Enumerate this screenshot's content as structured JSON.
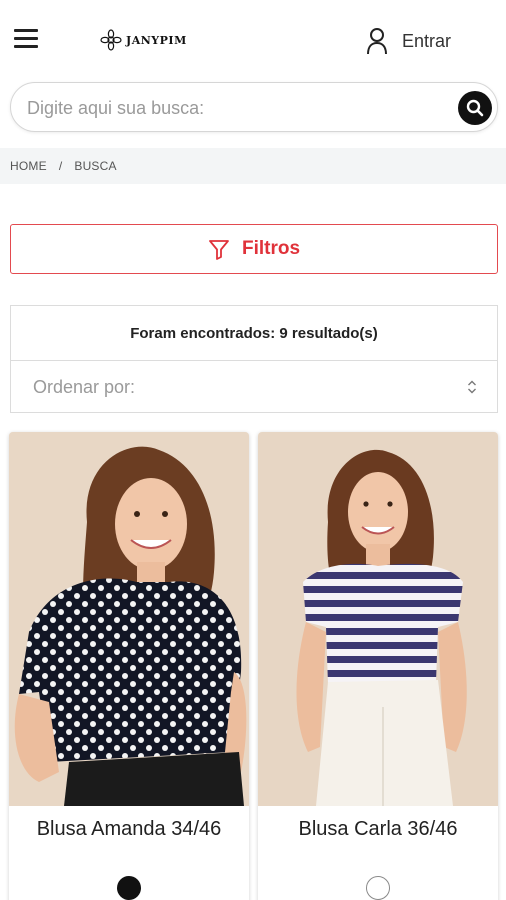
{
  "header": {
    "menu_icon": "hamburger-icon",
    "logo_text": "JANYPIM",
    "login_label": "Entrar",
    "login_icon": "user-icon"
  },
  "search": {
    "placeholder": "Digite aqui sua busca:",
    "icon": "search-icon"
  },
  "breadcrumb": {
    "items": [
      "HOME",
      "BUSCA"
    ],
    "separator": "/"
  },
  "filters": {
    "label": "Filtros",
    "icon": "filter-icon",
    "accent_color": "#e0323a"
  },
  "results": {
    "count_text": "Foram encontrados: 9 resultado(s)",
    "sort_placeholder": "Ordenar por:"
  },
  "products": [
    {
      "name": "Blusa Amanda 34/46",
      "swatch_color": "#111111"
    },
    {
      "name": "Blusa Carla 36/46",
      "swatch_color": "#ffffff"
    }
  ]
}
